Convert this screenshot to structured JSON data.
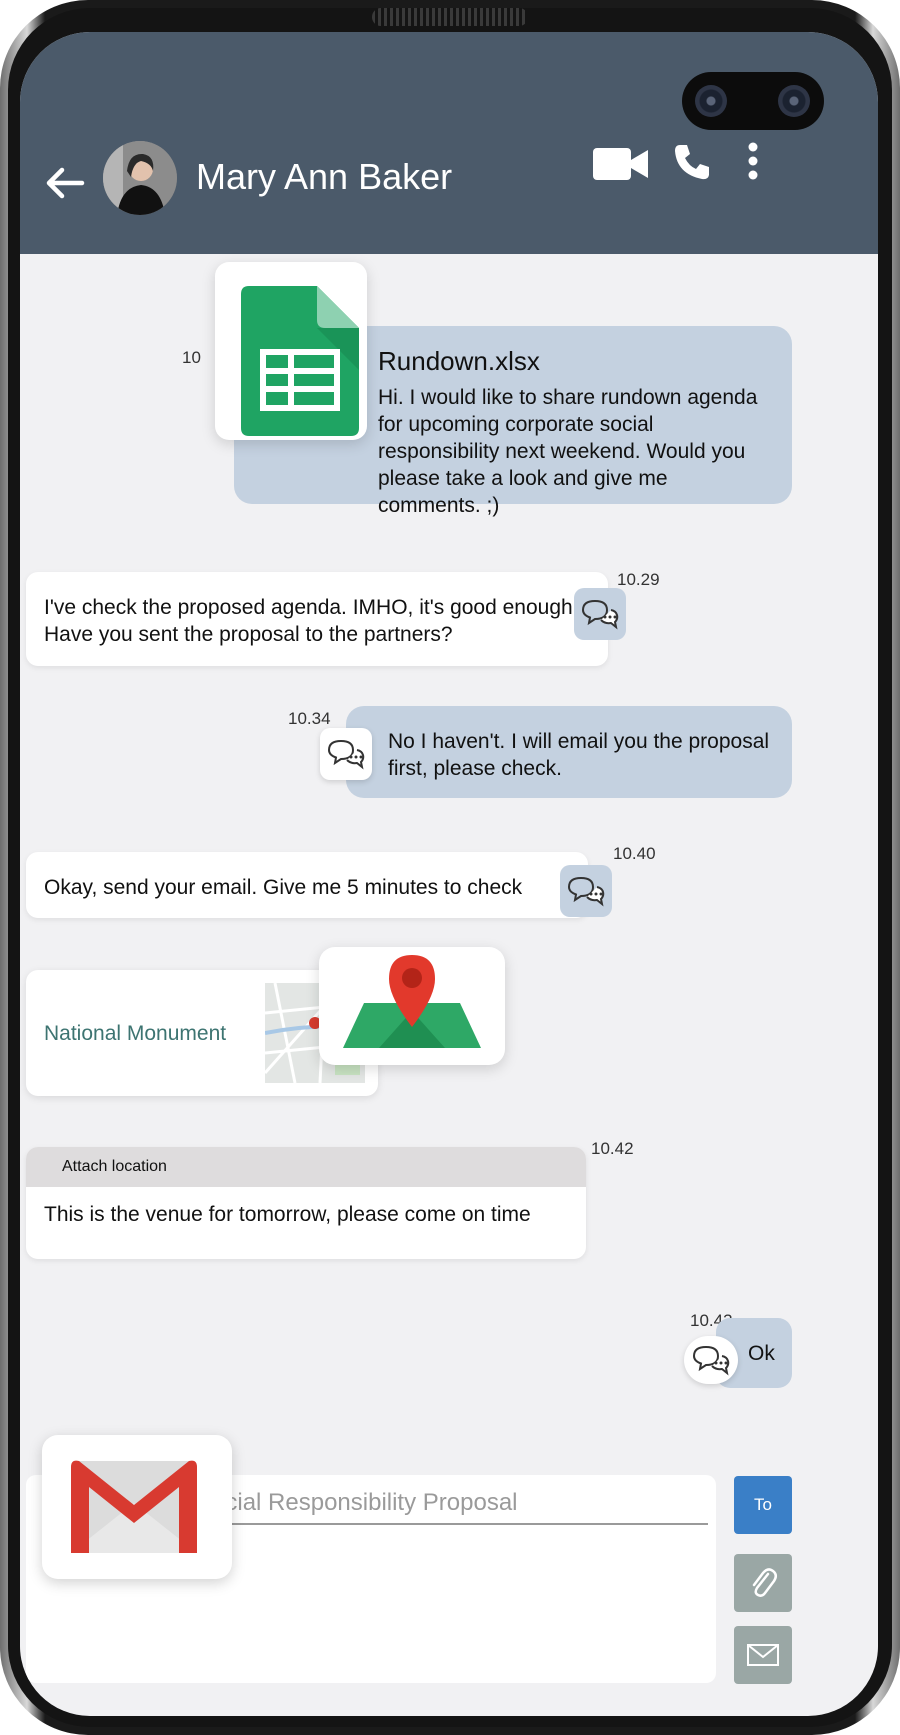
{
  "header": {
    "contact_name": "Mary Ann Baker",
    "icons": [
      "back-arrow-icon",
      "avatar",
      "video-camera-icon",
      "phone-icon",
      "more-vertical-icon"
    ],
    "background_color": "#4b5a6a"
  },
  "messages": {
    "file": {
      "time": "10",
      "filename": "Rundown.xlsx",
      "text": "Hi. I would like to share rundown agenda for upcoming corporate social responsibility next weekend. Would you please take a look and give me comments. ;)",
      "icon": "google-sheets-icon"
    },
    "m1": {
      "time": "10.29",
      "text": "I've check the proposed agenda. IMHO, it's good enough. Have you sent the proposal to the partners?"
    },
    "m2": {
      "time": "10.34",
      "text": "No I haven't. I will email you the proposal first, please check."
    },
    "m3": {
      "time": "10.40",
      "text": "Okay, send your email. Give me 5 minutes to check"
    },
    "location": {
      "place": "National Monument",
      "icon": "map-pin-icon"
    },
    "m4": {
      "time": "10.42",
      "label": "Attach location",
      "text": "This is the venue for tomorrow, please come on time"
    },
    "m5": {
      "time": "10.43",
      "text": "Ok"
    }
  },
  "compose": {
    "subject_value": "Social Responsibility Proposal",
    "to_label": "To",
    "icons": [
      "gmail-icon",
      "paperclip-icon",
      "envelope-icon"
    ]
  },
  "colors": {
    "incoming_bubble": "#ffffff",
    "outgoing_bubble": "#c4d1e0",
    "to_button": "#3a7fc7",
    "gray_button": "#9aa7a5",
    "location_text": "#3d7471"
  }
}
